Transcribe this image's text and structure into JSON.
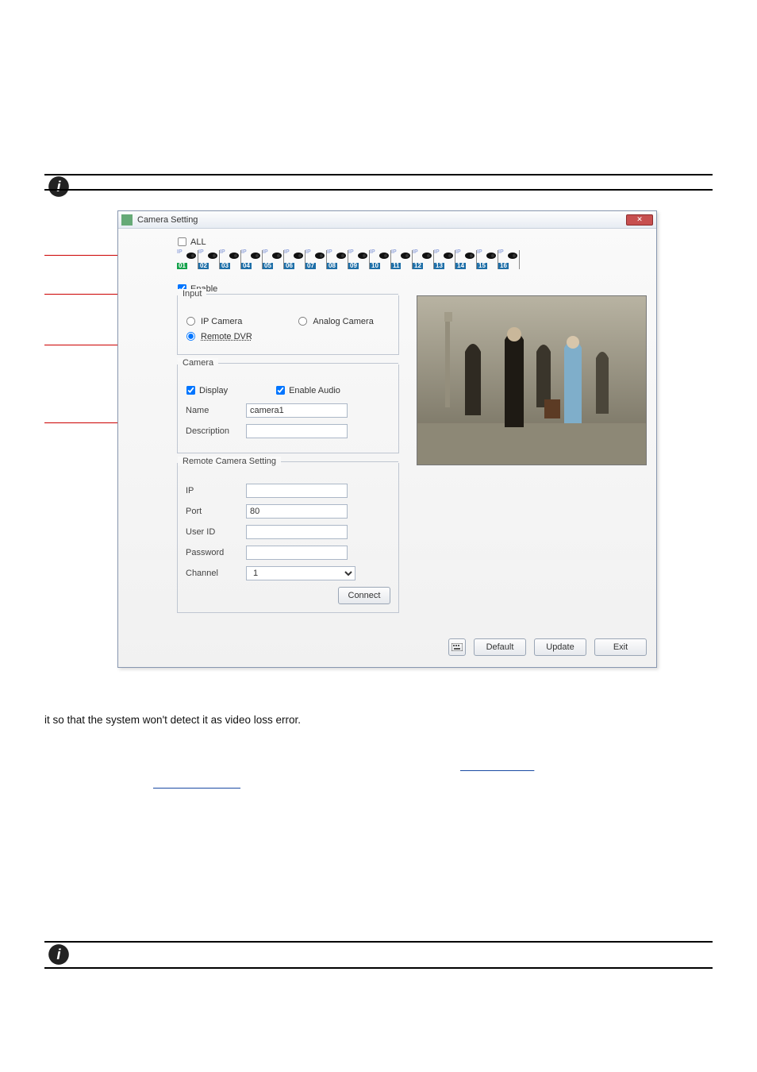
{
  "dialog": {
    "title": "Camera Setting",
    "all_label": "ALL",
    "enable_label": "Enable",
    "camera_tabs": [
      "01",
      "02",
      "03",
      "04",
      "05",
      "06",
      "07",
      "08",
      "09",
      "10",
      "11",
      "12",
      "13",
      "14",
      "15",
      "16"
    ],
    "ip_badge": "IP"
  },
  "groups": {
    "input": "Input",
    "camera": "Camera",
    "remote": "Remote Camera Setting"
  },
  "input": {
    "ip_camera": "IP Camera",
    "analog_camera": "Analog Camera",
    "remote_dvr": "Remote DVR"
  },
  "camera": {
    "display": "Display",
    "enable_audio": "Enable Audio",
    "name_label": "Name",
    "name_value": "camera1",
    "desc_label": "Description",
    "desc_value": ""
  },
  "remote": {
    "ip_label": "IP",
    "ip_value": "",
    "port_label": "Port",
    "port_value": "80",
    "user_label": "User ID",
    "user_value": "",
    "pass_label": "Password",
    "pass_value": "",
    "channel_label": "Channel",
    "channel_value": "1",
    "connect": "Connect"
  },
  "footer": {
    "default": "Default",
    "update": "Update",
    "exit": "Exit"
  },
  "page": {
    "line1": "it so that the system won't detect it as video loss error.",
    "note": ""
  }
}
